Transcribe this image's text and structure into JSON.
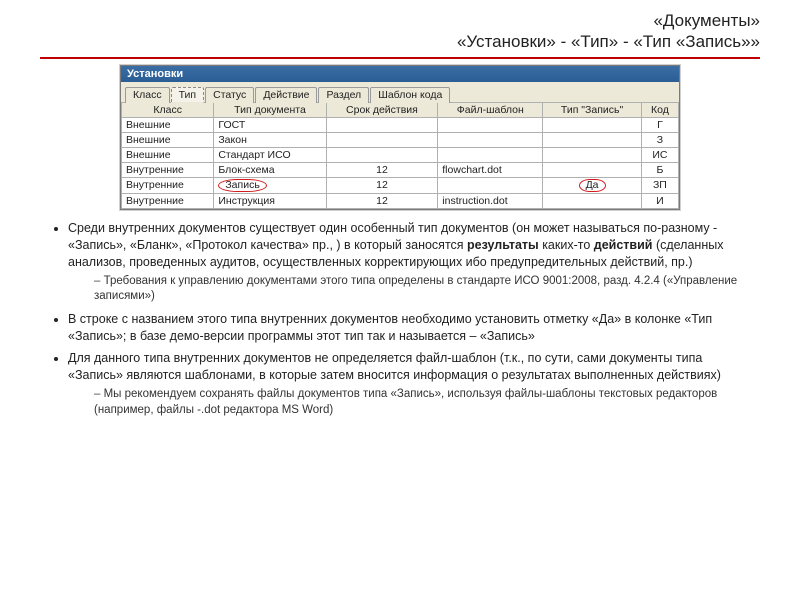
{
  "header": {
    "line1": "«Документы»",
    "line2": "«Установки» - «Тип» - «Тип «Запись»»"
  },
  "window": {
    "title": "Установки",
    "tabs": [
      "Класс",
      "Тип",
      "Статус",
      "Действие",
      "Раздел",
      "Шаблон кода"
    ],
    "active_tab": 1,
    "columns": [
      "Класс",
      "Тип документа",
      "Срок действия",
      "Файл-шаблон",
      "Тип \"Запись\"",
      "Код"
    ],
    "rows": [
      {
        "class": "Внешние",
        "doc": "ГОСТ",
        "term": "",
        "tpl": "",
        "rec": "",
        "code": "Г"
      },
      {
        "class": "Внешние",
        "doc": "Закон",
        "term": "",
        "tpl": "",
        "rec": "",
        "code": "З"
      },
      {
        "class": "Внешние",
        "doc": "Стандарт ИСО",
        "term": "",
        "tpl": "",
        "rec": "",
        "code": "ИС"
      },
      {
        "class": "Внутренние",
        "doc": "Блок-схема",
        "term": "12",
        "tpl": "flowchart.dot",
        "rec": "",
        "code": "Б"
      },
      {
        "class": "Внутренние",
        "doc": "Запись",
        "doc_circled": true,
        "term": "12",
        "tpl": "",
        "rec": "Да",
        "rec_circled": true,
        "code": "ЗП"
      },
      {
        "class": "Внутренние",
        "doc": "Инструкция",
        "term": "12",
        "tpl": "instruction.dot",
        "rec": "",
        "code": "И"
      }
    ]
  },
  "body": {
    "b1_a": "Среди внутренних документов существует один особенный тип документов (он может  называться по-разному - «Запись», «Бланк», «Протокол качества» пр., ) в который заносятся ",
    "b1_bold1": "результаты",
    "b1_mid": " каких-то ",
    "b1_bold2": "действий",
    "b1_b": " (сделанных анализов, проведенных аудитов, осуществленных корректирующих ибо предупредительных действий, пр.)",
    "b1_sub": "Требования к управлению документами этого типа определены в стандарте ИСО 9001:2008, разд. 4.2.4 («Управление записями»)",
    "b2": "В строке с названием этого типа внутренних документов необходимо установить отметку «Да» в колонке «Тип «Запись»; в базе демо-версии программы этот тип так и называется – «Запись»",
    "b3": "Для данного типа внутренних документов не определяется файл-шаблон (т.к., по сути, сами документы типа «Запись» являются шаблонами, в которые затем вносится информация о результатах выполненных действиях)",
    "b3_sub": "Мы рекомендуем сохранять файлы документов типа «Запись», используя файлы-шаблоны текстовых редакторов (например, файлы -.dot редактора MS Word)"
  }
}
